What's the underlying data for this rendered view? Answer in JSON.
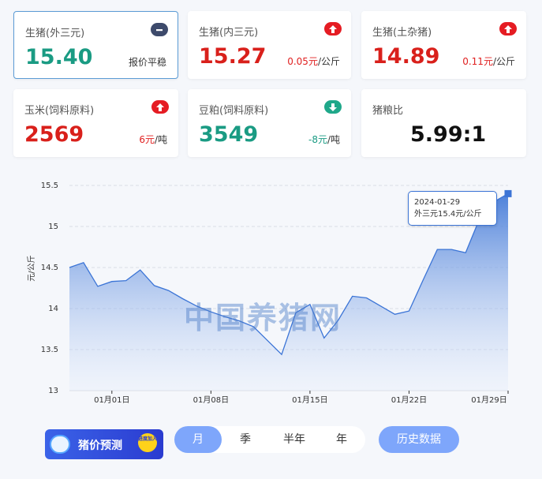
{
  "cards": [
    {
      "label": "生猪(外三元)",
      "value": "15.40",
      "change_num": "",
      "change_unit": "报价平稳",
      "trend": "flat"
    },
    {
      "label": "生猪(内三元)",
      "value": "15.27",
      "change_num": "0.05元",
      "change_unit": "/公斤",
      "trend": "up"
    },
    {
      "label": "生猪(土杂猪)",
      "value": "14.89",
      "change_num": "0.11元",
      "change_unit": "/公斤",
      "trend": "up"
    },
    {
      "label": "玉米(饲料原料)",
      "value": "2569",
      "change_num": "6元",
      "change_unit": "/吨",
      "trend": "up"
    },
    {
      "label": "豆粕(饲料原料)",
      "value": "3549",
      "change_num": "-8元",
      "change_unit": "/吨",
      "trend": "down"
    },
    {
      "label": "猪粮比",
      "value": "5.99:1",
      "change_num": "",
      "change_unit": "",
      "trend": "none"
    }
  ],
  "colors": {
    "up": "#d9201b",
    "down": "#1a9b83",
    "accent": "#7ea6fb",
    "line": "#3b74d6"
  },
  "chart_data": {
    "type": "area",
    "ylabel": "元/公斤",
    "ylim": [
      13,
      15.5
    ],
    "yticks": [
      "15.5",
      "15",
      "14.5",
      "14",
      "13.5",
      "13"
    ],
    "xticks": [
      "01月01日",
      "01月08日",
      "01月15日",
      "01月22日",
      "01月29日"
    ],
    "x": [
      "12-29",
      "12-30",
      "12-31",
      "01-01",
      "01-02",
      "01-03",
      "01-04",
      "01-05",
      "01-06",
      "01-07",
      "01-08",
      "01-09",
      "01-10",
      "01-11",
      "01-12",
      "01-13",
      "01-14",
      "01-15",
      "01-16",
      "01-17",
      "01-18",
      "01-19",
      "01-20",
      "01-21",
      "01-22",
      "01-23",
      "01-24",
      "01-25",
      "01-26",
      "01-27",
      "01-28",
      "01-29"
    ],
    "values": [
      14.5,
      14.56,
      14.27,
      14.33,
      14.34,
      14.47,
      14.28,
      14.22,
      14.12,
      14.03,
      13.96,
      13.9,
      13.85,
      13.78,
      13.61,
      13.44,
      13.95,
      14.05,
      13.64,
      13.86,
      14.15,
      14.13,
      14.03,
      13.93,
      13.97,
      14.35,
      14.72,
      14.72,
      14.68,
      15.1,
      15.3,
      15.4
    ],
    "tooltip_date": "2024-01-29",
    "tooltip_text": "外三元15.4元/公斤",
    "watermark": "中国养猪网"
  },
  "promo": {
    "label": "猪价预测",
    "coin": "进度加入"
  },
  "periods": [
    "月",
    "季",
    "半年",
    "年"
  ],
  "active_period": "月",
  "history_label": "历史数据"
}
